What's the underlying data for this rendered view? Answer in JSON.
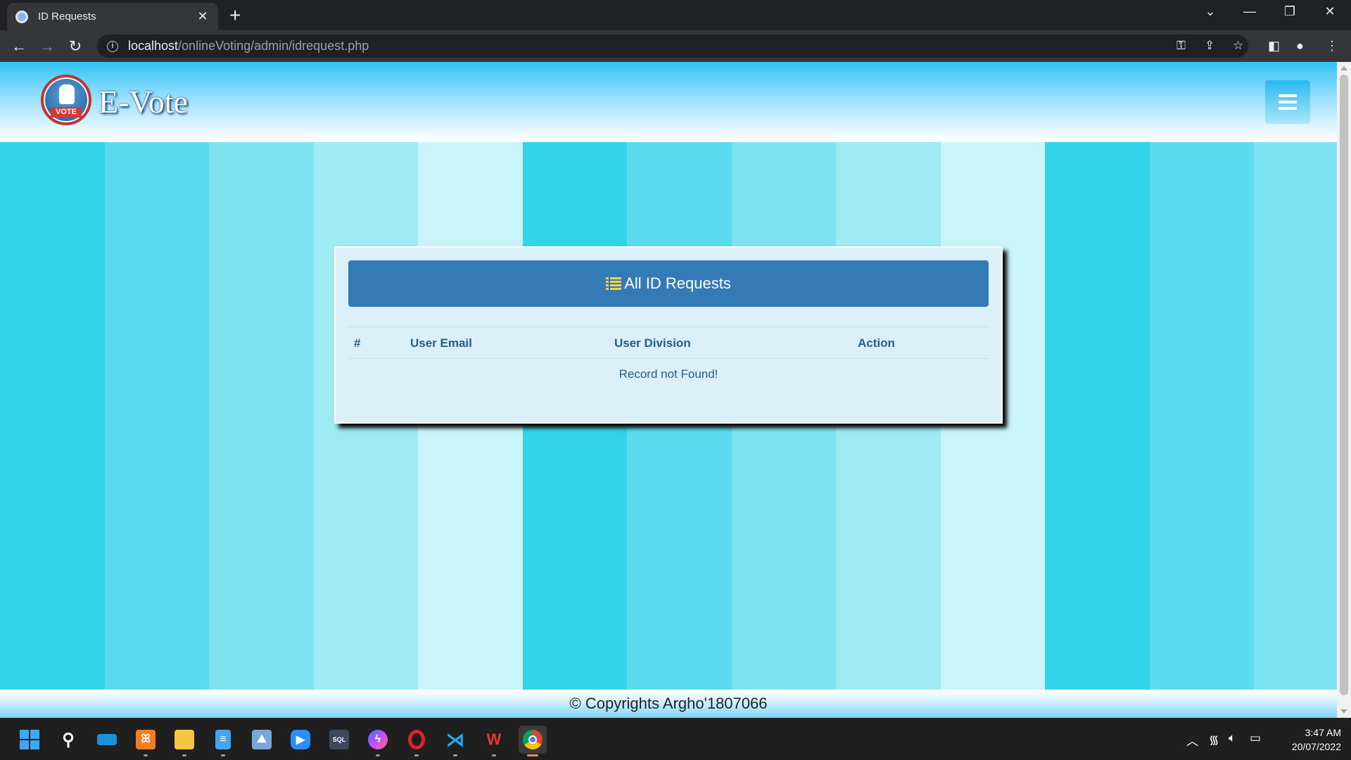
{
  "browser": {
    "tab_title": "ID Requests",
    "url_host": "localhost",
    "url_path": "/onlineVoting/admin/idrequest.php"
  },
  "header": {
    "brand": "E-Vote",
    "logo_text": "VOTE"
  },
  "card": {
    "title": "All ID Requests",
    "columns": [
      "#",
      "User Email",
      "User Division",
      "Action"
    ],
    "empty_message": "Record not Found!"
  },
  "footer": {
    "text": "© Copyrights Argho'1807066"
  },
  "taskbar": {
    "time": "3:47 AM",
    "date": "20/07/2022",
    "apps": [
      "start",
      "search",
      "task-view",
      "xampp",
      "file-explorer",
      "notepad",
      "photos",
      "zoom",
      "sql",
      "messenger",
      "opera",
      "vscode",
      "wps-office",
      "chrome"
    ]
  },
  "colors": {
    "stripes": [
      "#33d4ea",
      "#5bdcee",
      "#7ee3f1",
      "#9eebf4",
      "#c8f4fa"
    ],
    "card_header": "#337ab7",
    "accent_text": "#235f86"
  }
}
